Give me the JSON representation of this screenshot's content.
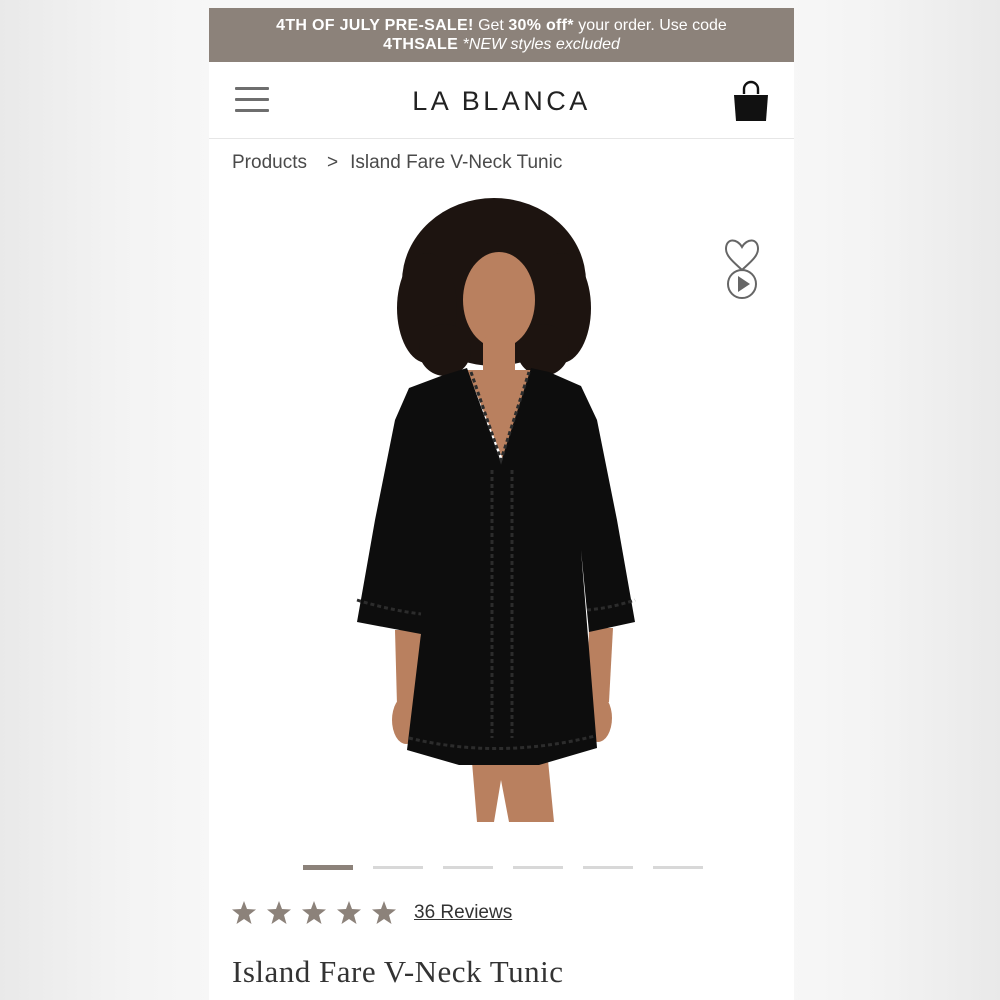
{
  "promo": {
    "headline": "4TH OF JULY PRE-SALE!",
    "get_text": "Get",
    "discount": "30% off*",
    "order_text": "your order. Use code",
    "code": "4THSALE",
    "note": "*NEW styles excluded",
    "bg_color": "#8c827a"
  },
  "header": {
    "menu_icon": "hamburger-menu-icon",
    "logo": "LA BLANCA",
    "cart_icon": "shopping-bag-icon"
  },
  "breadcrumb": {
    "root": "Products",
    "separator": ">",
    "current": "Island Fare V-Neck Tunic"
  },
  "gallery": {
    "image_icon": "product-photo-model-in-black-tunic",
    "actions": [
      "heart-icon",
      "play-video-icon"
    ],
    "slide_count": 6,
    "active_slide": 1
  },
  "product": {
    "rating": 5,
    "max_rating": 5,
    "reviews_label": "36 Reviews",
    "title": "Island Fare V-Neck Tunic",
    "star_color": "#8c827a"
  }
}
